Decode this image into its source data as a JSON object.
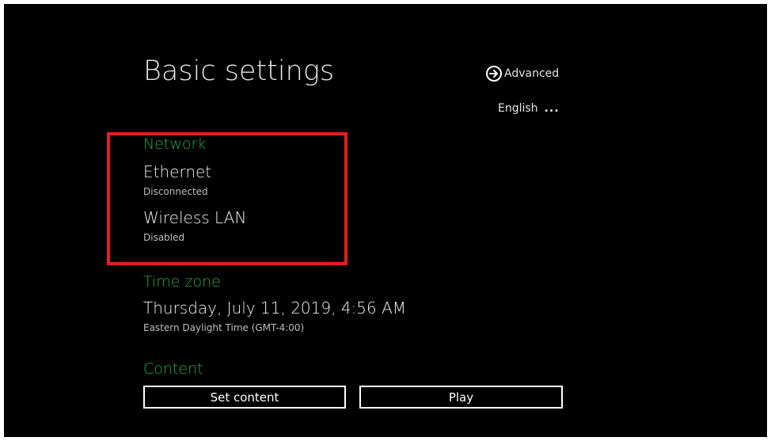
{
  "header": {
    "title": "Basic settings",
    "advanced_label": "Advanced",
    "language_label": "English",
    "language_more": "..."
  },
  "network": {
    "title": "Network",
    "ethernet": {
      "label": "Ethernet",
      "status": "Disconnected"
    },
    "wireless": {
      "label": "Wireless LAN",
      "status": "Disabled"
    }
  },
  "timezone": {
    "title": "Time zone",
    "datetime": "Thursday, July 11, 2019, 4:56 AM",
    "zone": "Eastern Daylight Time (GMT-4:00)"
  },
  "content": {
    "title": "Content",
    "set_content_label": "Set content",
    "play_label": "Play"
  },
  "colors": {
    "background": "#000000",
    "accent_green": "#22a845",
    "highlight_red": "#e02020",
    "text": "#ffffff"
  },
  "icons": {
    "advanced": "arrow-circle-right-icon"
  }
}
